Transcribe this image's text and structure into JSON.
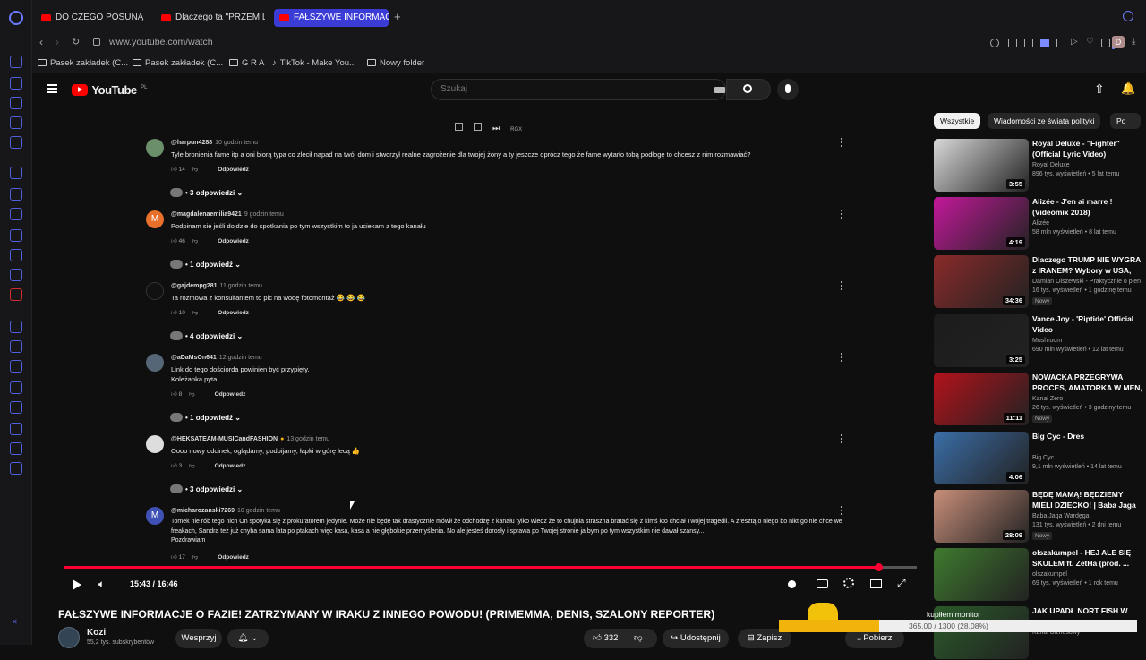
{
  "browser": {
    "tabs": [
      {
        "label": "DO CZEGO POSUNĄ SIĘ K"
      },
      {
        "label": "Dlaczego ta \"PRZEMILA\""
      },
      {
        "label": "FAŁSZYWE INFORMACJE"
      }
    ],
    "url": "www.youtube.com/watch",
    "bookmarks": [
      "Pasek zakładek (C...",
      "Pasek zakładek (C...",
      "G R A",
      "TikTok - Make You...",
      "Nowy folder"
    ],
    "profile_initial": "D"
  },
  "youtube": {
    "logo": "YouTube",
    "region": "PL",
    "search_placeholder": "Szukaj"
  },
  "comments": [
    {
      "author": "@harpun4288",
      "time": "10 godzin temu",
      "avatar": "",
      "avatar_color": "#6b8f6b",
      "text": "Tyle bronienia fame itp a oni biorą typa co zlecił napad na twój dom i stworzył realne zagrożenie dla twojej żony a ty jeszcze oprócz tego że fame wytarło tobą podłogę to chcesz z nim rozmawiać?",
      "likes": "14",
      "reply_label": "Odpowiedz",
      "replies": "3 odpowiedzi"
    },
    {
      "author": "@magdalenaemilia9421",
      "time": "9 godzin temu",
      "avatar": "M",
      "avatar_color": "#e8702a",
      "text": "Podpinam się jeśli dojdzie do spotkania po tym wszystkim to ja uciekam z tego kanału",
      "likes": "46",
      "reply_label": "Odpowiedz",
      "replies": "1 odpowiedź"
    },
    {
      "author": "@gajdempg281",
      "time": "11 godzin temu",
      "avatar": "",
      "avatar_color": "#111111",
      "text": "Ta rozmowa z konsultantem to pic na wodę fotomontaż 😂 😂 😂",
      "likes": "10",
      "reply_label": "Odpowiedz",
      "replies": "4 odpowiedzi"
    },
    {
      "author": "@aDaMsOn641",
      "time": "12 godzin temu",
      "avatar": "",
      "avatar_color": "#556677",
      "text": "Link do tego dościorda powinien być przypięty.\nKoleżanka pyta.",
      "likes": "8",
      "reply_label": "Odpowiedz",
      "replies": "1 odpowiedź"
    },
    {
      "author": "@HEKSATEAM-MUSICandFASHION",
      "time": "13 godzin temu",
      "avatar": "",
      "avatar_color": "#dddddd",
      "text": "Oooo nowy odcinek, oglądamy, podbijamy, łapki w górę lecą 👍",
      "likes": "3",
      "reply_label": "Odpowiedz",
      "replies": "3 odpowiedzi"
    },
    {
      "author": "@micharozanski7269",
      "time": "10 godzin temu",
      "avatar": "M",
      "avatar_color": "#3f51b5",
      "text": "Tomek nie rób tego nich On spotyka się z prokuratorem jedynie. Może nie będę tak drastycznie mówił że odchodzę z kanału tylko wiedz że to chujnia straszna bratać się z kimś kto chciał Twojej tragedii. A zresztą o niego bo nikt go nie chce we freakach, Sandra też już chyba sama lata po ptakach więc kasa, kasa a nie głębokie przemyślenia. No ale jesteś dorosły i sprawa po Twojej stronie ja bym po tym wszystkim nie dawał szansy...\nPozdrawiam",
      "likes": "17",
      "reply_label": "Odpowiedz",
      "replies": ""
    }
  ],
  "player": {
    "time": "15:43 / 16:46",
    "progress": 0.956
  },
  "video": {
    "title": "FAŁSZYWE INFORMACJE O FAZIE! ZATRZYMANY W IRAKU Z INNEGO POWODU! (PRIMEMMA, DENIS, SZALONY REPORTER)",
    "channel": "Kozi",
    "subscribers": "55,2 tys. subskrybentów",
    "support_label": "Wesprzyj",
    "likes": "332",
    "share_label": "Udostępnij",
    "save_label": "Zapisz",
    "download_label": "Pobierz"
  },
  "sidebar": {
    "chips": [
      "Wszystkie",
      "Wiadomości ze świata polityki",
      "Po"
    ],
    "recs": [
      {
        "title": "Royal Deluxe - \"Fighter\" (Official Lyric Video)",
        "channel": "Royal Deluxe",
        "meta": "896 tys. wyświetleń • 5 lat temu",
        "duration": "3:55",
        "badge": "",
        "thumb_color": "#d9d9d9"
      },
      {
        "title": "Alizée - J'en ai marre ! (Videomix 2018)",
        "channel": "Alizée",
        "meta": "58 mln wyświetleń • 8 lat temu",
        "duration": "4:19",
        "badge": "",
        "thumb_color": "#c3189a"
      },
      {
        "title": "Dlaczego TRUMP NIE WYGRA z IRANEM? Wybory w USA, Akta...",
        "channel": "Damian Olszewski - Praktycznie o pien",
        "meta": "16 tys. wyświetleń • 1 godzinę temu",
        "duration": "34:36",
        "badge": "Nowy",
        "thumb_color": "#8a2a2a"
      },
      {
        "title": "Vance Joy - 'Riptide' Official Video",
        "channel": "Mushroom",
        "meta": "690 mln wyświetleń • 12 lat temu",
        "duration": "3:25",
        "badge": "",
        "thumb_color": "#1c1c1c"
      },
      {
        "title": "NOWACKA PRZEGRYWA PROCES, AMATORKA W MEN, ...",
        "channel": "Kanał Zero",
        "meta": "26 tys. wyświetleń • 3 godziny temu",
        "duration": "11:11",
        "badge": "Nowy",
        "thumb_color": "#b3121c"
      },
      {
        "title": "Big Cyc - Dres",
        "channel": "Big Cyc",
        "meta": "9,1 mln wyświetleń • 14 lat temu",
        "duration": "4:06",
        "badge": "",
        "thumb_color": "#3b6ea8"
      },
      {
        "title": "BĘDĘ MAMĄ! BĘDZIEMY MIELI DZIECKO! | Baba Jaga Wardęga",
        "channel": "Baba Jaga Wardęga",
        "meta": "131 tys. wyświetleń • 2 dni temu",
        "duration": "28:09",
        "badge": "Nowy",
        "thumb_color": "#c98f7a"
      },
      {
        "title": "olszakumpel - HEJ ALE SIĘ SKULEM ft. ZetHa (prod. ...",
        "channel": "olszakumpel",
        "meta": "69 tys. wyświetleń • 1 rok temu",
        "duration": "",
        "badge": "",
        "thumb_color": "#3e7a2e"
      },
      {
        "title": "JAK UPADŁ NORT FISH W",
        "channel": "Kanał Biznesowy",
        "meta": "",
        "duration": "",
        "badge": "",
        "thumb_color": "#2a5a2a"
      }
    ]
  },
  "download_overlay": {
    "name": "kupiłem monitor",
    "progress_text": "365.00 / 1300 (28.08%)",
    "progress": 0.28
  },
  "colors": {
    "accent": "#ff0033",
    "tab_active": "#3b3bd6",
    "leftbar_icons": "#5b6cff"
  }
}
